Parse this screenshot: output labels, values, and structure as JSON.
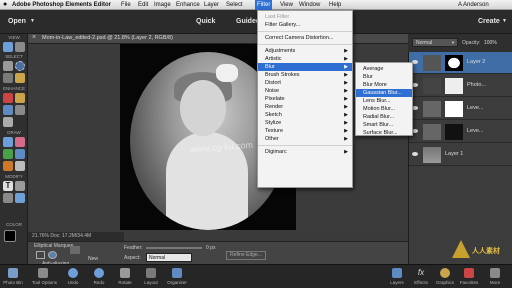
{
  "menubar": {
    "app": "Adobe Photoshop Elements Editor",
    "items": [
      "File",
      "Edit",
      "Image",
      "Enhance",
      "Layer",
      "Select",
      "Filter",
      "View",
      "Window",
      "Help"
    ],
    "user": "A Anderson"
  },
  "topbar": {
    "open_label": "Open",
    "mode_tabs": [
      "Quick",
      "Guided"
    ],
    "create_label": "Create"
  },
  "document": {
    "tab_title": "Mom-in-Law_edited-2.psd @ 21.8% (Layer 2, RGB/8)",
    "status": "21.76%  Doc: 17.2M/34.4M"
  },
  "tools": {
    "sections": [
      "VIEW",
      "SELECT",
      "ENHANCE",
      "DRAW",
      "MODIFY",
      "COLOR"
    ]
  },
  "filter_menu": {
    "items": [
      {
        "label": "Last Filter",
        "disabled": true
      },
      {
        "label": "Filter Gallery...",
        "disabled": false
      },
      {
        "label": "Correct Camera Distortion...",
        "disabled": false
      },
      {
        "label": "Adjustments",
        "submenu": true
      },
      {
        "label": "Artistic",
        "submenu": true
      },
      {
        "label": "Blur",
        "submenu": true,
        "highlighted": true
      },
      {
        "label": "Brush Strokes",
        "submenu": true
      },
      {
        "label": "Distort",
        "submenu": true
      },
      {
        "label": "Noise",
        "submenu": true
      },
      {
        "label": "Pixelate",
        "submenu": true
      },
      {
        "label": "Render",
        "submenu": true
      },
      {
        "label": "Sketch",
        "submenu": true
      },
      {
        "label": "Stylize",
        "submenu": true
      },
      {
        "label": "Texture",
        "submenu": true
      },
      {
        "label": "Other",
        "submenu": true
      },
      {
        "label": "Digimarc",
        "submenu": true
      }
    ]
  },
  "blur_menu": {
    "items": [
      "Average",
      "Blur",
      "Blur More",
      "Gaussian Blur...",
      "Lens Blur...",
      "Motion Blur...",
      "Radial Blur...",
      "Smart Blur...",
      "Surface Blur..."
    ],
    "selected": "Gaussian Blur..."
  },
  "layers_panel": {
    "blend_mode": "Normal",
    "opacity_label": "Opacity:",
    "opacity_value": "100%",
    "layers": [
      {
        "name": "Layer 2",
        "selected": true
      },
      {
        "name": "Photo...",
        "selected": false
      },
      {
        "name": "Leve...",
        "selected": false
      },
      {
        "name": "Leve...",
        "selected": false
      },
      {
        "name": "Layer 1",
        "selected": false
      }
    ]
  },
  "tool_options": {
    "title": "Elliptical Marquee",
    "feather_label": "Feather:",
    "feather_value": "0 px",
    "new_label": "New",
    "aspect_label": "Aspect:",
    "aspect_value": "Normal",
    "antialias_label": "Anti-aliasing",
    "refine_label": "Refine Edge..."
  },
  "bottombar": {
    "left": [
      "Photo Bin",
      "Tool Options",
      "Undo",
      "Redo",
      "Rotate",
      "Layout",
      "Organizer"
    ],
    "right": [
      "Layers",
      "Effects",
      "Graphics",
      "Favorites",
      "More"
    ]
  },
  "watermark": {
    "canvas_text": "www.cg-ku.com",
    "logo_text": "人人素材"
  },
  "colors": {
    "highlight": "#2f6fd3",
    "layer_selected": "#3f6ea6",
    "panel_dark": "#2b2b2b"
  }
}
